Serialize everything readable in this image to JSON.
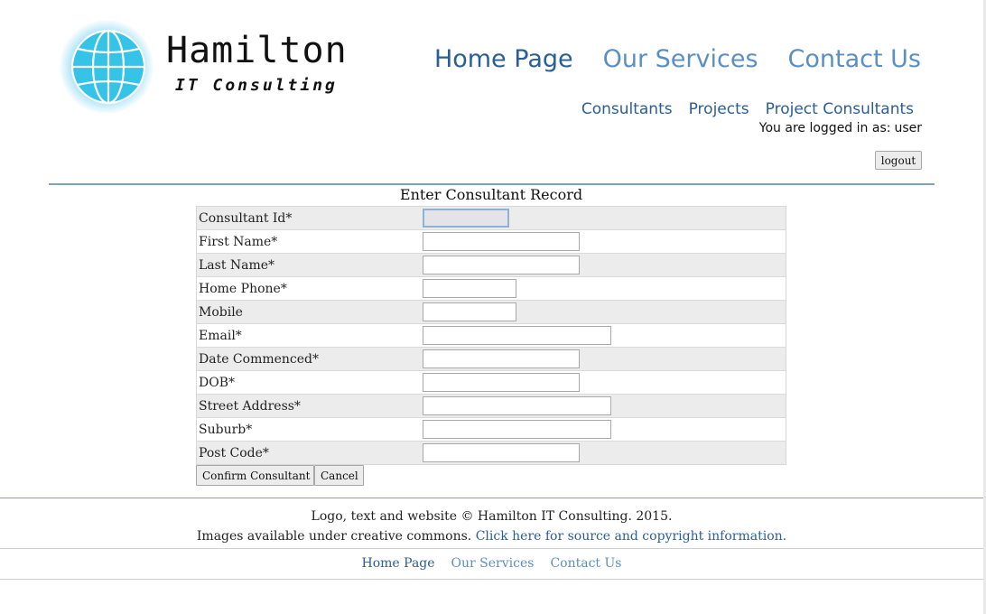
{
  "brand": {
    "title": "Hamilton",
    "subtitle": "IT Consulting",
    "globe_color": "#36c3e8",
    "link_color": "#2a5e96",
    "link_muted_color": "#5b8fc4"
  },
  "main_nav": [
    {
      "label": "Home Page"
    },
    {
      "label": "Our Services"
    },
    {
      "label": "Contact Us"
    }
  ],
  "sub_nav": [
    {
      "label": "Consultants"
    },
    {
      "label": "Projects"
    },
    {
      "label": "Project Consultants"
    }
  ],
  "session": {
    "logged_in_text": "You are logged in as:",
    "username": "user",
    "logout_label": "logout"
  },
  "form": {
    "title": "Enter Consultant Record",
    "fields": [
      {
        "label": "Consultant Id*",
        "value": ""
      },
      {
        "label": "First Name*",
        "value": ""
      },
      {
        "label": "Last Name*",
        "value": ""
      },
      {
        "label": "Home Phone*",
        "value": ""
      },
      {
        "label": "Mobile",
        "value": ""
      },
      {
        "label": "Email*",
        "value": ""
      },
      {
        "label": "Date Commenced*",
        "value": ""
      },
      {
        "label": "DOB*",
        "value": ""
      },
      {
        "label": "Street Address*",
        "value": ""
      },
      {
        "label": "Suburb*",
        "value": ""
      },
      {
        "label": "Post Code*",
        "value": ""
      }
    ],
    "confirm_label": "Confirm Consultant",
    "cancel_label": "Cancel"
  },
  "footer": {
    "copyright": "Logo, text and website © Hamilton IT Consulting. 2015.",
    "images_text": "Images available under creative commons.",
    "images_link": "Click here for source and copyright information.",
    "nav": [
      {
        "label": "Home Page"
      },
      {
        "label": "Our Services"
      },
      {
        "label": "Contact Us"
      }
    ]
  }
}
